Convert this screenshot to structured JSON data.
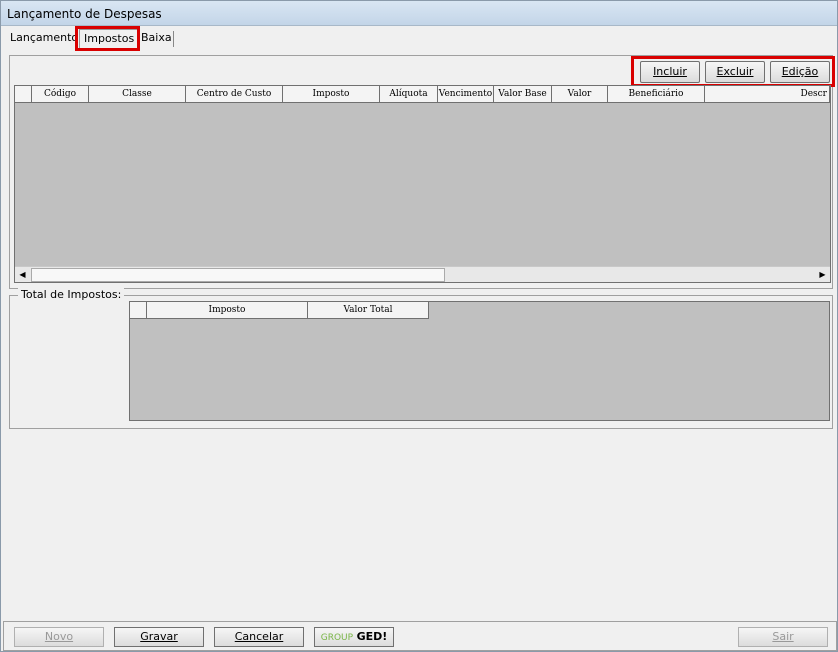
{
  "window": {
    "title": "Lançamento de Despesas"
  },
  "tabs": [
    {
      "label": "Lançamento"
    },
    {
      "label": "Impostos",
      "active": true
    },
    {
      "label": "Baixa"
    }
  ],
  "toolbar": {
    "incluir": "Incluir",
    "excluir": "Excluir",
    "edicao": "Edição"
  },
  "grid": {
    "columns": [
      "",
      "Código",
      "Classe",
      "Centro de Custo",
      "Imposto",
      "Alíquota",
      "Vencimento",
      "Valor Base",
      "Valor",
      "Beneficiário",
      "Descr"
    ]
  },
  "totals": {
    "label": "Total de Impostos:",
    "columns": [
      "",
      "Imposto",
      "Valor Total"
    ]
  },
  "footer": {
    "novo": "Novo",
    "gravar": "Gravar",
    "cancelar": "Cancelar",
    "ged_group": "GROUP",
    "ged_brand": "GED!",
    "sair": "Sair"
  },
  "colors": {
    "highlight": "#d90000",
    "grid_bg": "#c0c0c0"
  }
}
